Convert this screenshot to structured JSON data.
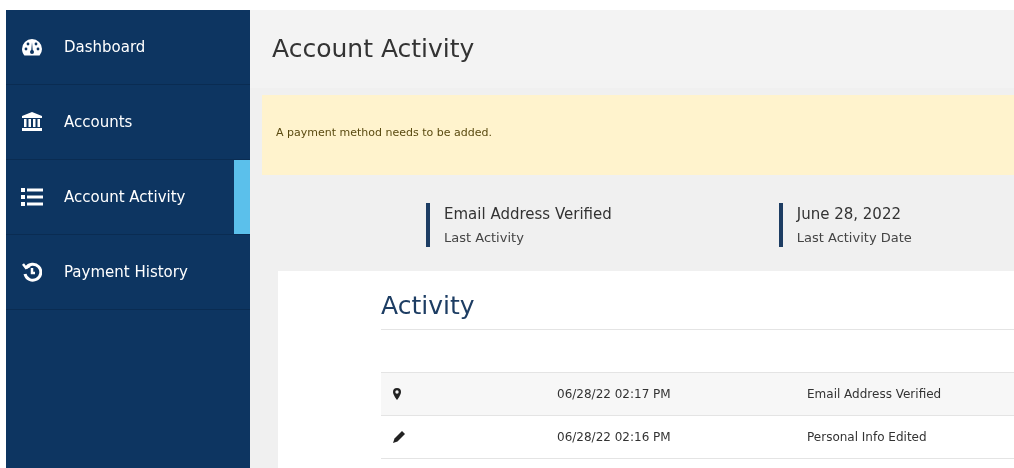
{
  "sidebar": {
    "items": [
      {
        "label": "Dashboard",
        "kind": "gauge",
        "selected": false
      },
      {
        "label": "Accounts",
        "kind": "bank",
        "selected": false
      },
      {
        "label": "Account Activity",
        "kind": "list",
        "selected": true
      },
      {
        "label": "Payment History",
        "kind": "history",
        "selected": false
      }
    ]
  },
  "page_title": "Account Activity",
  "alert": "A payment method needs to be added.",
  "stats": [
    {
      "value": "Email Address Verified",
      "label": "Last Activity"
    },
    {
      "value": "June 28, 2022",
      "label": "Last Activity Date"
    }
  ],
  "activity": {
    "title": "Activity",
    "rows": [
      {
        "kind": "pin",
        "time": "06/28/22 02:17 PM",
        "event": "Email Address Verified"
      },
      {
        "kind": "pencil",
        "time": "06/28/22 02:16 PM",
        "event": "Personal Info Edited"
      }
    ]
  }
}
